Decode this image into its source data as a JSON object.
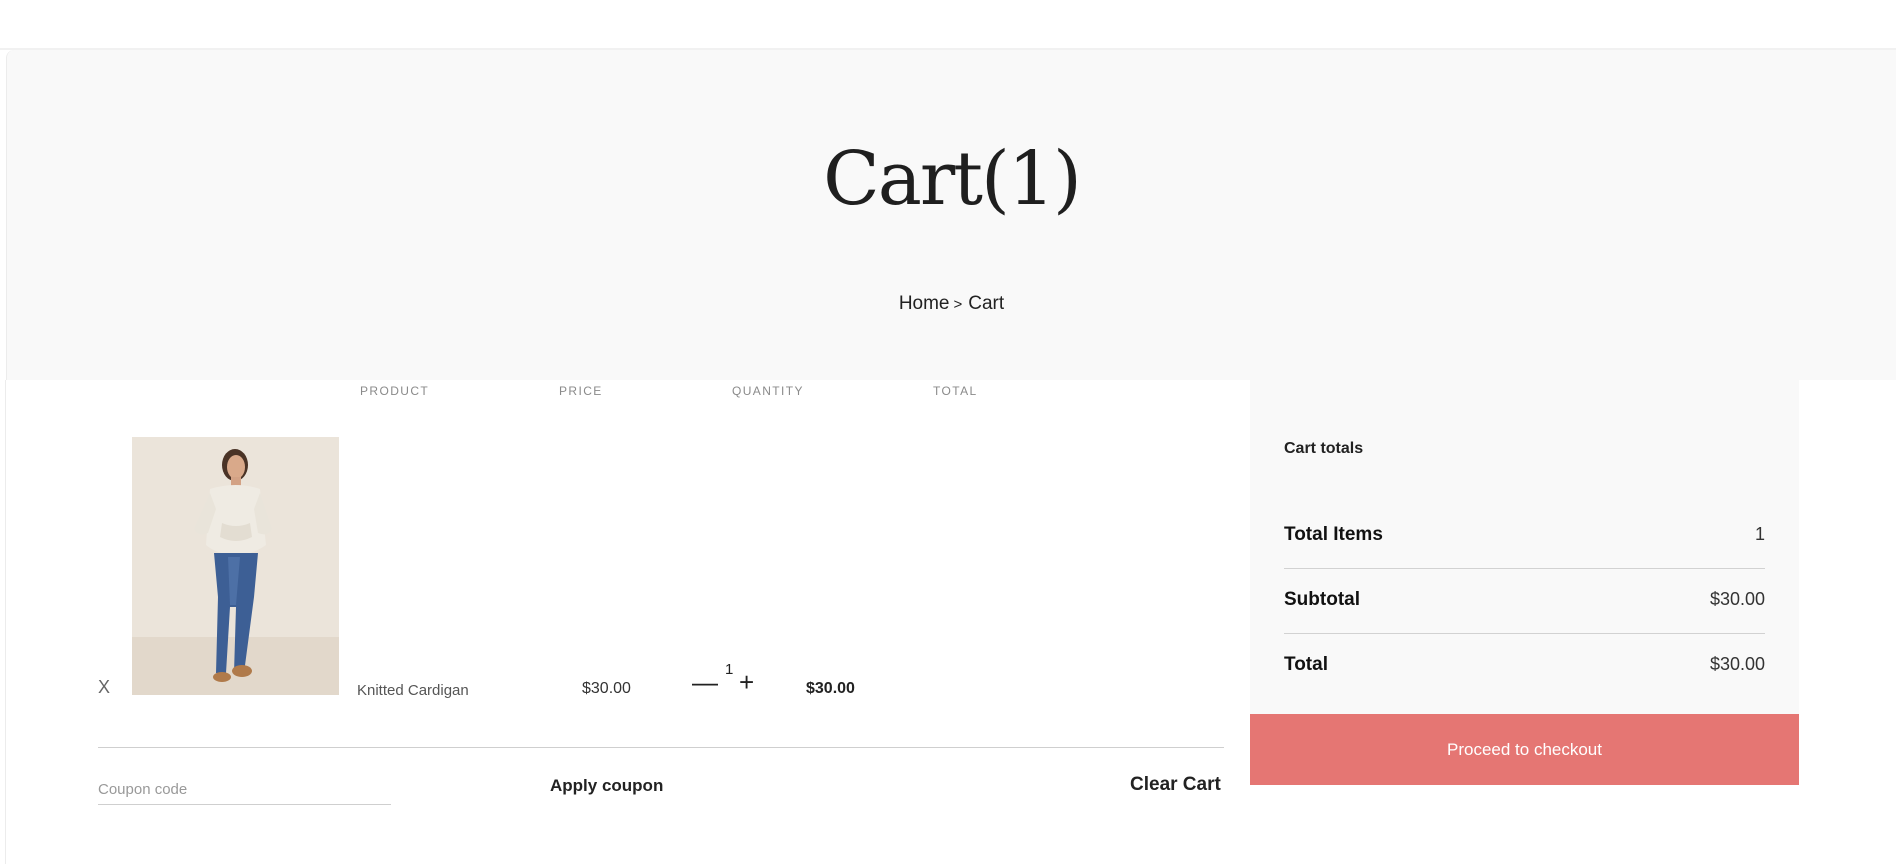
{
  "hero": {
    "title": "Cart(1)",
    "breadcrumb": {
      "home": "Home",
      "separator": ">",
      "current": "Cart"
    }
  },
  "cart_table": {
    "headers": [
      "PRODUCT",
      "PRICE",
      "QUANTITY",
      "TOTAL"
    ],
    "items": [
      {
        "remove": "X",
        "image": "product-photo",
        "name": "Knitted Cardigan",
        "price": "$30.00",
        "qty_minus": "—",
        "quantity": "1",
        "qty_plus": "+",
        "total": "$30.00"
      }
    ]
  },
  "actions": {
    "coupon_placeholder": "Coupon code",
    "apply_label": "Apply coupon",
    "clear_label": "Clear Cart"
  },
  "totals": {
    "heading": "Cart totals",
    "rows": [
      {
        "label": "Total Items",
        "value": "1"
      },
      {
        "label": "Subtotal",
        "value": "$30.00"
      },
      {
        "label": "Total",
        "value": "$30.00"
      }
    ],
    "checkout_label": "Proceed to checkout"
  },
  "colors": {
    "hero_bg": "#f9f9f9",
    "checkout_bg": "#e57673",
    "divider": "#cfcfcf"
  }
}
